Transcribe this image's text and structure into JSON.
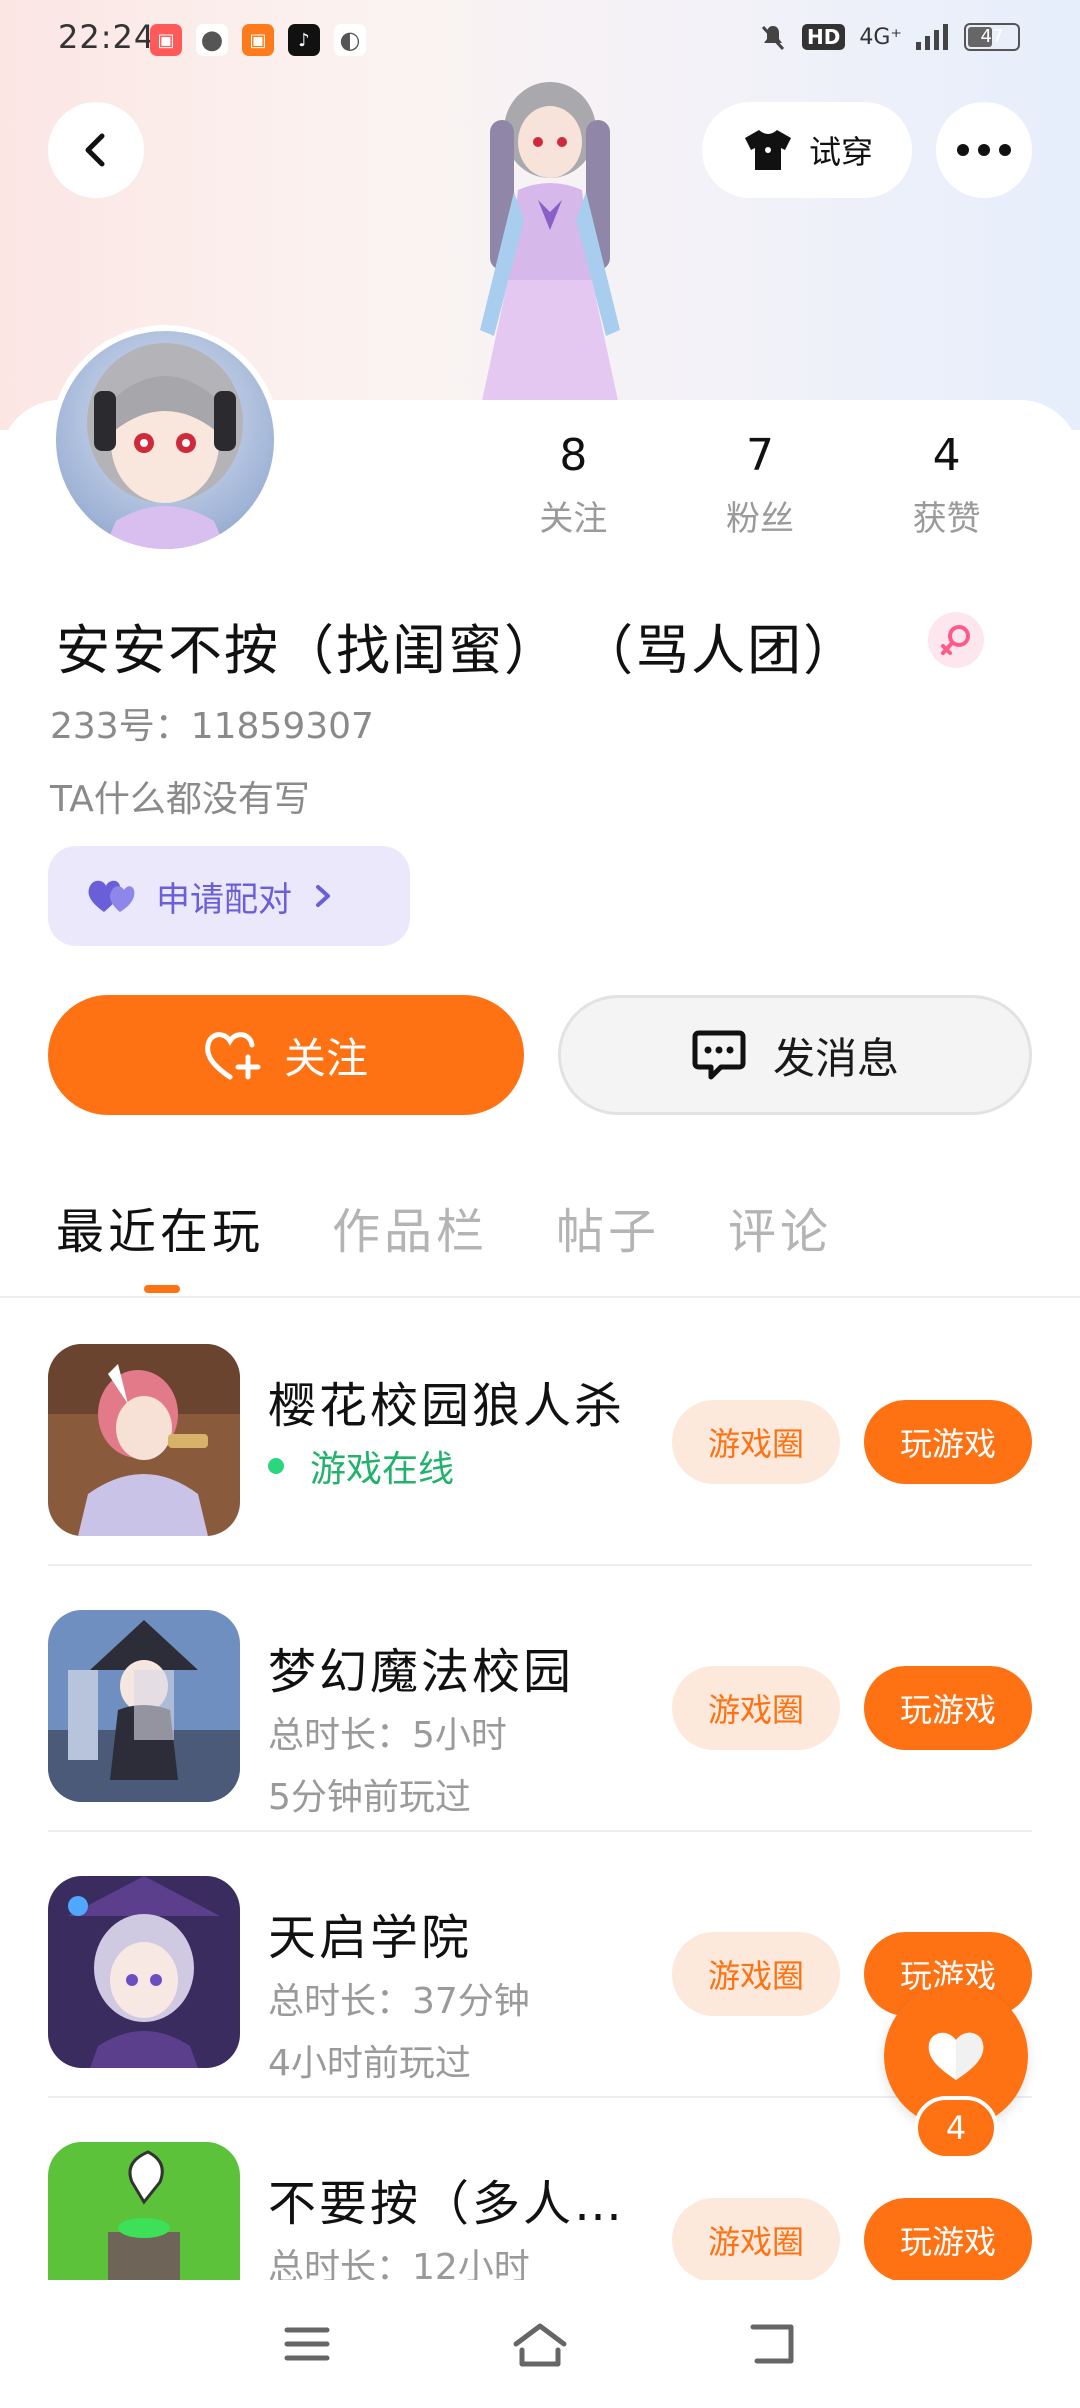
{
  "status_bar": {
    "time": "22:24",
    "network": "4G⁺",
    "hd": "HD",
    "battery": "47"
  },
  "header": {
    "try_on_label": "试穿"
  },
  "profile": {
    "stats": [
      {
        "value": "8",
        "label": "关注"
      },
      {
        "value": "7",
        "label": "粉丝"
      },
      {
        "value": "4",
        "label": "获赞"
      }
    ],
    "username": "安安不按（找闺蜜） （骂人团）",
    "uid": "233号：11859307",
    "bio": "TA什么都没有写",
    "pair_label": "申请配对"
  },
  "actions": {
    "follow_label": "关注",
    "message_label": "发消息"
  },
  "tabs": [
    {
      "label": "最近在玩",
      "active": true
    },
    {
      "label": "作品栏",
      "active": false
    },
    {
      "label": "帖子",
      "active": false
    },
    {
      "label": "评论",
      "active": false
    }
  ],
  "games": [
    {
      "title": "樱花校园狼人杀",
      "status": "游戏在线",
      "sub1": "",
      "sub2": "",
      "circle_label": "游戏圈",
      "play_label": "玩游戏"
    },
    {
      "title": "梦幻魔法校园",
      "status": "",
      "sub1": "总时长：5小时",
      "sub2": "5分钟前玩过",
      "circle_label": "游戏圈",
      "play_label": "玩游戏"
    },
    {
      "title": "天启学院",
      "status": "",
      "sub1": "总时长：37分钟",
      "sub2": "4小时前玩过",
      "circle_label": "游戏圈",
      "play_label": "玩游戏"
    },
    {
      "title": "不要按（多人…",
      "status": "",
      "sub1": "总时长：12小时",
      "sub2": "",
      "circle_label": "游戏圈",
      "play_label": "玩游戏"
    }
  ],
  "floating_like": {
    "count": "4"
  },
  "colors": {
    "accent": "#ff7214",
    "pair_purple": "#6a5fd8",
    "online_green": "#21b36c"
  }
}
